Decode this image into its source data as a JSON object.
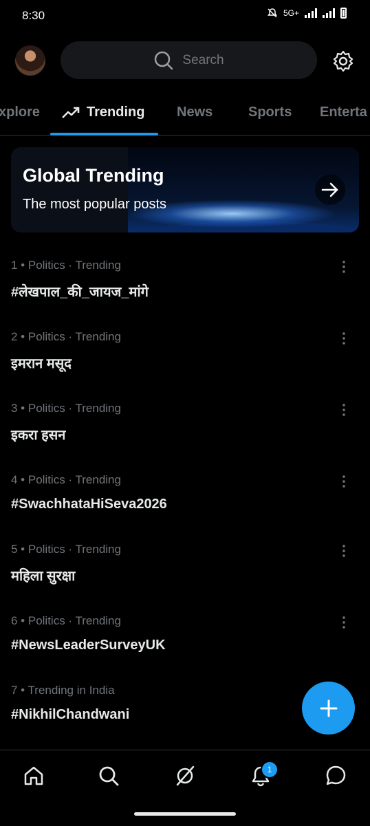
{
  "status": {
    "time": "8:30",
    "network": "5G+"
  },
  "search": {
    "placeholder": "Search"
  },
  "tabs": [
    {
      "label": "xplore"
    },
    {
      "label": "Trending"
    },
    {
      "label": "News"
    },
    {
      "label": "Sports"
    },
    {
      "label": "Enterta"
    }
  ],
  "banner": {
    "title": "Global Trending",
    "subtitle": "The most popular posts"
  },
  "trends": [
    {
      "meta": "1 • Politics · Trending",
      "title": "#लेखपाल_की_जायज_मांगे"
    },
    {
      "meta": "2 • Politics · Trending",
      "title": "इमरान मसूद"
    },
    {
      "meta": "3 • Politics · Trending",
      "title": "इकरा हसन"
    },
    {
      "meta": "4 • Politics · Trending",
      "title": "#SwachhataHiSeva2026"
    },
    {
      "meta": "5 • Politics · Trending",
      "title": "महिला सुरक्षा"
    },
    {
      "meta": "6 • Politics · Trending",
      "title": "#NewsLeaderSurveyUK"
    },
    {
      "meta": "7 • Trending in India",
      "title": "#NikhilChandwani"
    }
  ],
  "nav": {
    "notifications_badge": "1"
  },
  "colors": {
    "accent": "#1d9bf0",
    "background": "#000000",
    "muted": "#71767b"
  }
}
